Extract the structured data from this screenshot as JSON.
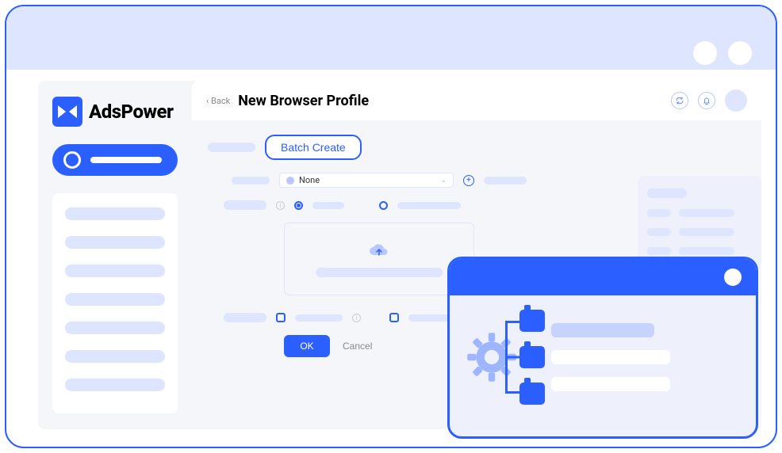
{
  "brand": "AdsPower",
  "back": "‹ Back",
  "page_title": "New Browser Profile",
  "batch_create": "Batch Create",
  "select": {
    "value": "None"
  },
  "buttons": {
    "ok": "OK",
    "cancel": "Cancel"
  },
  "colors": {
    "primary": "#2c5fff",
    "light": "#dde5ff"
  }
}
